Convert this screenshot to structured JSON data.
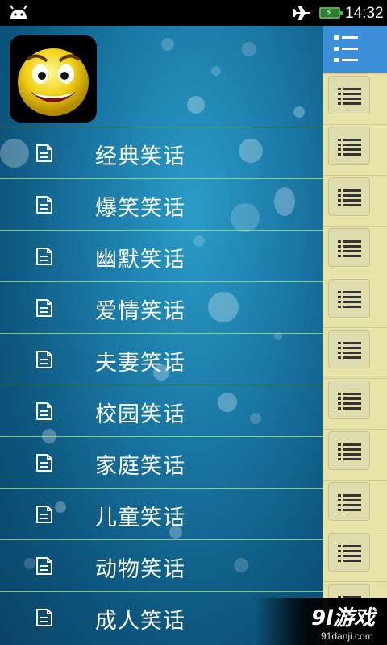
{
  "status": {
    "time": "14:32"
  },
  "menu": {
    "items": [
      {
        "label": "经典笑话"
      },
      {
        "label": "爆笑笑话"
      },
      {
        "label": "幽默笑话"
      },
      {
        "label": "爱情笑话"
      },
      {
        "label": "夫妻笑话"
      },
      {
        "label": "校园笑话"
      },
      {
        "label": "家庭笑话"
      },
      {
        "label": "儿童笑话"
      },
      {
        "label": "动物笑话"
      },
      {
        "label": "成人笑话"
      }
    ]
  },
  "watermark": {
    "brand": "9l游戏",
    "site": "91danji.com"
  },
  "icons": {
    "status": [
      "android-icon",
      "airplane-mode-icon",
      "battery-charging-icon"
    ],
    "menu_item": "document-icon",
    "sidebar": "list-menu-icon",
    "app_logo": "smiley-face-icon"
  },
  "colors": {
    "sidebar_bg": "#e8e3a6",
    "sidebar_top_button": "#3d8fd8",
    "divider": "#bee678",
    "main_bg": "#1b7aa6"
  }
}
